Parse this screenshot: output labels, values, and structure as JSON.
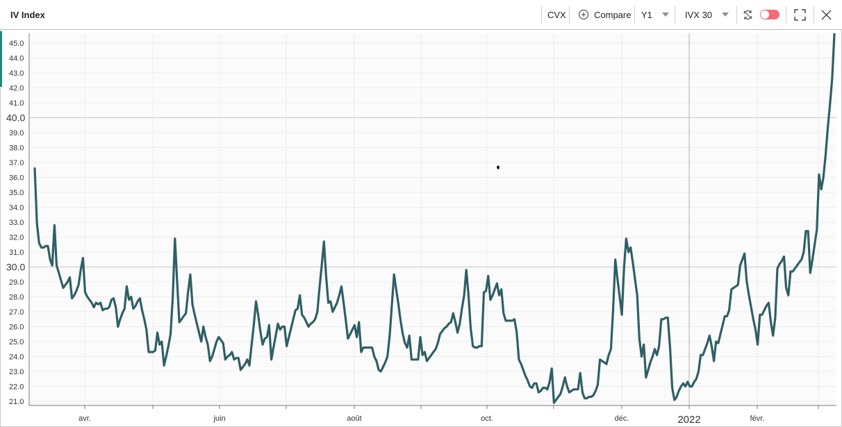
{
  "header": {
    "title": "IV Index",
    "ticker": "CVX",
    "compare_label": "Compare",
    "period": "Y1",
    "indicator": "IVX 30",
    "icons": [
      "plus-circle-icon",
      "refresh-icon",
      "toggle-switch",
      "fullscreen-icon",
      "close-icon"
    ]
  },
  "colors": {
    "line": "#2f5f66",
    "grid_major": "#c8c8c8",
    "grid_minor": "#ececec",
    "toggle": "#f46a75"
  },
  "chart_data": {
    "type": "line",
    "title": "",
    "xlabel": "",
    "ylabel": "",
    "ylim": [
      20.7,
      45.6
    ],
    "y_ticks": [
      "21.0",
      "22.0",
      "23.0",
      "24.0",
      "25.0",
      "26.0",
      "27.0",
      "28.0",
      "29.0",
      "30.0",
      "31.0",
      "32.0",
      "33.0",
      "34.0",
      "35.0",
      "36.0",
      "37.0",
      "38.0",
      "39.0",
      "40.0",
      "41.0",
      "42.0",
      "43.0",
      "44.0",
      "45.0"
    ],
    "y_major": [
      "30.0",
      "40.0"
    ],
    "x_labels": [
      "avr.",
      "juin",
      "août",
      "oct.",
      "déc.",
      "2022",
      "févr."
    ],
    "grid": true,
    "series": [
      {
        "values": [
          36.6,
          32.9,
          31.6,
          31.3,
          31.3,
          31.4,
          31.4,
          30.5,
          30.1,
          32.8,
          30.1,
          29.6,
          29.1,
          28.6,
          28.8,
          29.0,
          29.3,
          27.9,
          28.1,
          28.4,
          28.8,
          29.8,
          30.6,
          28.3,
          28.0,
          27.8,
          27.6,
          27.3,
          27.6,
          27.5,
          27.6,
          27.1,
          27.2,
          27.2,
          27.3,
          27.8,
          27.9,
          27.3,
          26.0,
          26.5,
          26.9,
          27.2,
          28.7,
          27.8,
          28.0,
          27.2,
          27.4,
          27.7,
          27.9,
          27.1,
          26.5,
          25.8,
          24.3,
          24.3,
          24.3,
          24.4,
          25.6,
          24.8,
          25.0,
          23.4,
          24.0,
          24.7,
          25.5,
          28.0,
          31.9,
          29.0,
          26.3,
          26.5,
          26.7,
          26.9,
          28.3,
          29.5,
          27.5,
          26.8,
          26.2,
          25.6,
          25.0,
          26.0,
          25.3,
          24.8,
          23.7,
          24.0,
          24.5,
          25.0,
          25.3,
          25.1,
          24.9,
          23.8,
          24.0,
          24.1,
          24.3,
          23.8,
          23.9,
          23.9,
          23.1,
          23.3,
          23.5,
          23.8,
          23.4,
          24.8,
          26.1,
          27.7,
          26.8,
          25.7,
          24.8,
          25.2,
          25.3,
          26.1,
          23.8,
          24.6,
          25.4,
          26.2,
          25.8,
          26.0,
          26.0,
          24.7,
          25.3,
          25.9,
          26.5,
          27.1,
          27.2,
          28.1,
          26.8,
          26.6,
          26.3,
          26.0,
          26.2,
          26.3,
          26.5,
          27.0,
          28.6,
          30.1,
          31.7,
          29.4,
          27.6,
          27.7,
          27.0,
          27.3,
          27.6,
          28.1,
          28.7,
          27.6,
          26.4,
          25.2,
          25.5,
          25.8,
          26.1,
          25.3,
          26.3,
          24.3,
          24.6,
          24.6,
          24.6,
          24.6,
          24.6,
          24.0,
          23.7,
          23.1,
          23.0,
          23.3,
          23.6,
          24.0,
          25.4,
          27.4,
          29.5,
          28.5,
          27.5,
          26.4,
          25.5,
          24.9,
          24.6,
          25.4,
          23.8,
          23.8,
          23.8,
          23.8,
          25.3,
          24.1,
          24.3,
          23.7,
          23.9,
          24.1,
          24.3,
          24.5,
          24.9,
          25.5,
          25.7,
          25.9,
          26.0,
          26.2,
          26.3,
          26.9,
          26.3,
          25.6,
          26.2,
          27.2,
          28.1,
          29.8,
          28.1,
          25.9,
          24.7,
          24.6,
          24.6,
          24.7,
          24.7,
          28.3,
          28.4,
          29.4,
          27.8,
          28.1,
          28.5,
          28.9,
          28.1,
          28.5,
          26.9,
          26.4,
          26.4,
          26.4,
          26.4,
          26.5,
          25.6,
          23.8,
          23.5,
          23.1,
          22.7,
          22.4,
          22.0,
          21.9,
          22.2,
          22.2,
          21.6,
          21.7,
          21.9,
          21.9,
          21.8,
          22.3,
          23.2,
          20.9,
          21.1,
          21.3,
          21.5,
          22.0,
          22.6,
          22.0,
          21.6,
          21.7,
          21.8,
          21.8,
          21.8,
          22.9,
          21.6,
          21.2,
          21.2,
          21.3,
          21.3,
          21.4,
          21.7,
          22.1,
          23.8,
          23.7,
          23.6,
          23.5,
          24.1,
          24.5,
          27.1,
          30.5,
          29.2,
          28.0,
          26.8,
          30.0,
          31.9,
          31.0,
          31.3,
          30.3,
          29.2,
          28.1,
          25.2,
          24.0,
          24.8,
          22.6,
          23.1,
          23.6,
          24.0,
          24.5,
          24.1,
          24.7,
          26.5,
          26.5,
          26.6,
          26.6,
          24.6,
          21.9,
          21.1,
          21.3,
          21.7,
          22.0,
          22.2,
          22.0,
          22.3,
          22.0,
          22.0,
          22.3,
          22.5,
          23.0,
          24.1,
          24.1,
          24.5,
          24.9,
          25.4,
          24.7,
          23.7,
          25.0,
          24.9,
          25.5,
          26.1,
          26.7,
          26.7,
          27.1,
          28.5,
          28.6,
          28.7,
          28.8,
          30.1,
          30.5,
          30.9,
          29.0,
          28.1,
          27.3,
          26.5,
          25.8,
          24.8,
          26.8,
          26.8,
          27.1,
          27.4,
          27.6,
          26.3,
          25.4,
          26.6,
          29.9,
          30.2,
          30.4,
          30.7,
          28.6,
          28.1,
          29.7,
          29.7,
          29.9,
          30.1,
          30.3,
          30.5,
          31.0,
          32.4,
          32.4,
          29.6,
          30.5,
          31.5,
          32.5,
          36.2,
          35.2,
          36.0,
          37.5,
          39.3,
          40.9,
          42.6,
          45.6
        ]
      }
    ]
  }
}
